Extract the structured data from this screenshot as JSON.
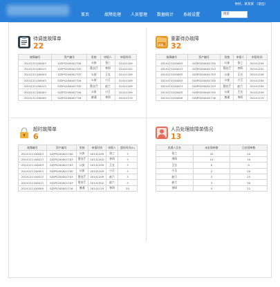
{
  "header": {
    "userline": "你好，某某某 （退出）",
    "nav": [
      "首页",
      "故障处理",
      "人员管理",
      "数据统计",
      "系统设置"
    ],
    "search_placeholder": "搜索"
  },
  "colors": {
    "brand": "#2a7fd8",
    "accent": "#f07e10"
  },
  "icons": {
    "pending": "clipboard-list-icon",
    "important": "important-folder-icon",
    "overdue": "padlock-icon",
    "stats": "person-icon"
  },
  "pending": {
    "title": "待调度故障单",
    "count": "22",
    "columns": [
      "故障编号",
      "资产编号",
      "系统",
      "申报人",
      "申报时间"
    ],
    "rows": [
      [
        "2014121100003",
        "GZJPS200001700",
        "公安",
        "张三",
        "20141209"
      ],
      [
        "2014121100013",
        "GZJPS200001703",
        "营业厅",
        "李四",
        "20141202"
      ],
      [
        "2014121100003",
        "GZJPS200001703",
        "公安",
        "王五",
        "20141209"
      ],
      [
        "2014121100003",
        "GZJPS200001700",
        "公安",
        "小王",
        "20141209"
      ],
      [
        "2014121100013",
        "GZJPS200001703",
        "营业厅",
        "赵六",
        "20141209"
      ],
      [
        "2014121100003",
        "GZJPS200001700",
        "公安",
        "小王",
        "20141209"
      ],
      [
        "2014121100009",
        "GZJPS200001716",
        "普通",
        "李四",
        "20141119"
      ]
    ]
  },
  "important": {
    "title": "重要待办故障",
    "count": "32",
    "badge": "重要",
    "columns": [
      "故障编号",
      "资产编号",
      "系统",
      "申报人",
      "申报时间"
    ],
    "rows": [
      [
        "2014121100003",
        "GZJPS200001700",
        "公安",
        "张三",
        "20141209"
      ],
      [
        "2014121100013",
        "GZJPS200001703",
        "营业厅",
        "李四",
        "20141202"
      ],
      [
        "2014121100003",
        "GZJPS200001703",
        "公安",
        "王五",
        "20141209"
      ],
      [
        "2014121100003",
        "GZJPS200001700",
        "公安",
        "小王",
        "20141209"
      ],
      [
        "2014121100013",
        "GZJPS200001703",
        "营业厅",
        "赵六",
        "20141209"
      ],
      [
        "2014121100003",
        "GZJPS200001700",
        "公安",
        "王五",
        "20141209"
      ],
      [
        "2014121100009",
        "GZJPS200001716",
        "普通",
        "李四",
        "20141119"
      ]
    ]
  },
  "overdue": {
    "title": "超时故障单",
    "count": "6",
    "columns": [
      "故障编号",
      "资产编号",
      "系统",
      "申报时间",
      "申报人",
      "超时时间(h)"
    ],
    "rows": [
      [
        "2014121100003",
        "GZJPS200001700",
        "公安",
        "20141209",
        "张三",
        "3"
      ],
      [
        "2014121100013",
        "GZJPS200001703",
        "营业厅",
        "20141202",
        "李四",
        "3"
      ],
      [
        "2014121100003",
        "GZJPS200001703",
        "公安",
        "20141209",
        "王五",
        "3"
      ],
      [
        "2014121100003",
        "GZJPS200001700",
        "公安",
        "20141209",
        "小王",
        "3"
      ],
      [
        "2014121100013",
        "GZJPS200001703",
        "营业厅",
        "20141209",
        "赵六",
        "3"
      ],
      [
        "2014121100013",
        "GZJPS200001703",
        "营业厅",
        "20141202",
        "赵六",
        "3"
      ],
      [
        "2014121100009",
        "GZJPS200001716",
        "普通",
        "20141119",
        "李四",
        "20"
      ]
    ]
  },
  "stats": {
    "title": "人员处理故障单情况",
    "count": "13",
    "columns": [
      "巡通人员名",
      "未处理单数",
      "已处理单数"
    ],
    "rows": [
      [
        "张三",
        "20",
        "20"
      ],
      [
        "李四",
        "10",
        "10"
      ],
      [
        "王五",
        "0",
        "0"
      ],
      [
        "小王",
        "2",
        "20"
      ],
      [
        "赵六",
        "3",
        "25"
      ],
      [
        "赵六",
        "3",
        "30"
      ],
      [
        "李四",
        "5",
        "22"
      ]
    ]
  }
}
